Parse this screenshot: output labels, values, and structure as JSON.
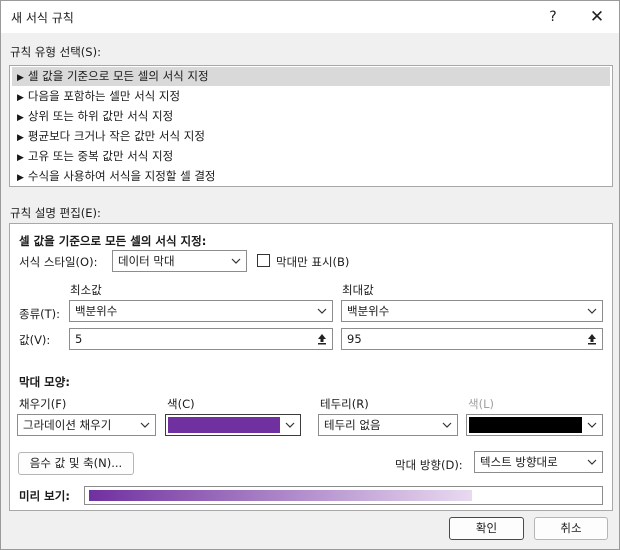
{
  "window": {
    "title": "새 서식 규칙",
    "help_label": "?",
    "close_label": "✕"
  },
  "rule_type": {
    "label": "규칙 유형 선택(S):",
    "items": [
      {
        "label": "셀 값을 기준으로 모든 셀의 서식 지정",
        "selected": true
      },
      {
        "label": "다음을 포함하는 셀만 서식 지정",
        "selected": false
      },
      {
        "label": "상위 또는 하위 값만 서식 지정",
        "selected": false
      },
      {
        "label": "평균보다 크거나 작은 값만 서식 지정",
        "selected": false
      },
      {
        "label": "고유 또는 중복 값만 서식 지정",
        "selected": false
      },
      {
        "label": "수식을 사용하여 서식을 지정할 셀 결정",
        "selected": false
      }
    ],
    "bullet": "▶"
  },
  "edit": {
    "label": "규칙 설명 편집(E):",
    "heading": "셀 값을 기준으로 모든 셀의 서식 지정:",
    "format_style_label": "서식 스타일(O):",
    "format_style_value": "데이터 막대",
    "bar_only_label": "막대만 표시(B)",
    "bar_only_checked": false,
    "min_header": "최소값",
    "max_header": "최대값",
    "type_label": "종류(T):",
    "min_type": "백분위수",
    "max_type": "백분위수",
    "value_label": "값(V):",
    "min_value": "5",
    "max_value": "95"
  },
  "bar_appearance": {
    "heading": "막대 모양:",
    "fill_label": "채우기(F)",
    "fill_value": "그라데이션 채우기",
    "fill_color_label": "색(C)",
    "fill_color": "#7030a0",
    "border_label": "테두리(R)",
    "border_value": "테두리 없음",
    "border_color_label": "색(L)",
    "border_color": "#000000",
    "negative_button": "음수 값 및 축(N)...",
    "direction_label": "막대 방향(D):",
    "direction_value": "텍스트 방향대로"
  },
  "preview": {
    "label": "미리 보기:",
    "color_start": "#7030a0",
    "color_end": "#e8daf0"
  },
  "footer": {
    "ok": "확인",
    "cancel": "취소"
  }
}
